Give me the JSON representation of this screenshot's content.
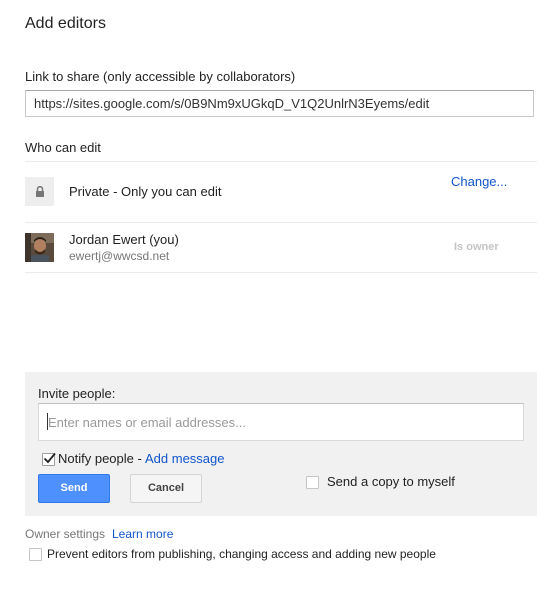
{
  "dialog": {
    "title": "Add editors"
  },
  "link_share": {
    "label": "Link to share (only accessible by collaborators)",
    "url": "https://sites.google.com/s/0B9Nm9xUGkqD_V1Q2UnlrN3Eyems/edit"
  },
  "who_can_edit": {
    "label": "Who can edit",
    "visibility": {
      "icon": "lock-icon",
      "text": "Private - Only you can edit",
      "change_link": "Change..."
    },
    "users": [
      {
        "name": "Jordan Ewert (you)",
        "email": "ewertj@wwcsd.net",
        "role": "Is owner"
      }
    ]
  },
  "invite": {
    "label": "Invite people:",
    "placeholder": "Enter names or email addresses...",
    "notify_label": "Notify people -",
    "notify_checked": true,
    "add_message_link": "Add message",
    "send_button": "Send",
    "cancel_button": "Cancel",
    "send_copy_label": "Send a copy to myself",
    "send_copy_checked": false
  },
  "owner_settings": {
    "label": "Owner settings",
    "learn_more": "Learn more",
    "prevent_label": "Prevent editors from publishing, changing access and adding new people",
    "prevent_checked": false
  },
  "colors": {
    "link": "#1155cc",
    "primary_button": "#4d90fe",
    "panel_background": "#f1f1f1"
  }
}
